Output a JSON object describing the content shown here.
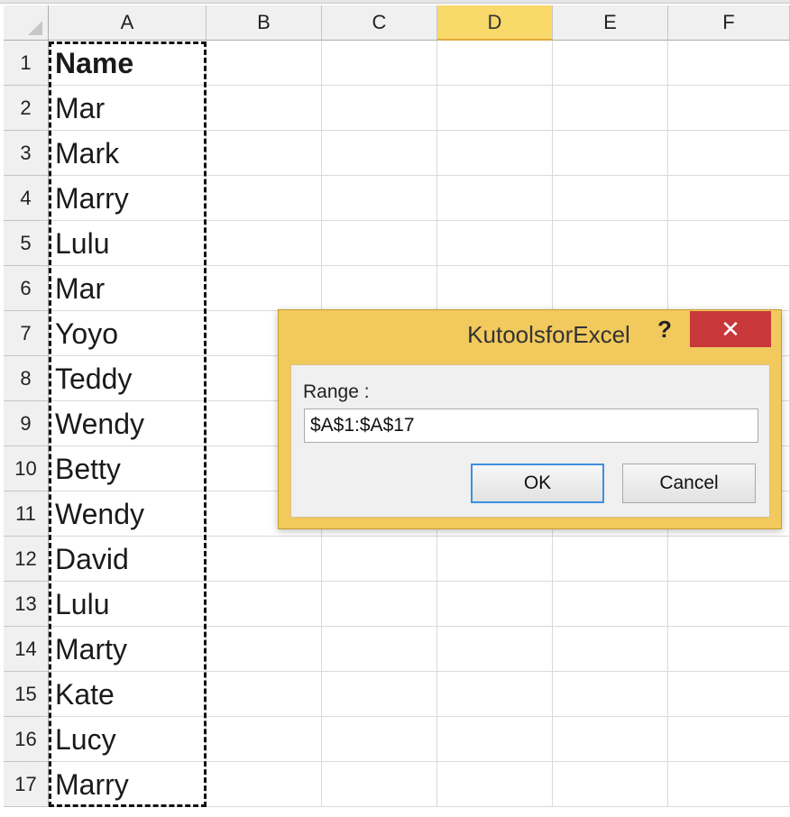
{
  "columns": [
    "A",
    "B",
    "C",
    "D",
    "E",
    "F"
  ],
  "selected_column": "D",
  "rows": [
    "1",
    "2",
    "3",
    "4",
    "5",
    "6",
    "7",
    "8",
    "9",
    "10",
    "11",
    "12",
    "13",
    "14",
    "15",
    "16",
    "17"
  ],
  "column_a_values": [
    "Name",
    "Mar",
    "Mark",
    "Marry",
    "Lulu",
    "Mar",
    "Yoyo",
    "Teddy",
    "Wendy",
    "Betty",
    "Wendy",
    "David",
    "Lulu",
    "Marty",
    "Kate",
    "Lucy",
    "Marry"
  ],
  "dialog": {
    "title": "KutoolsforExcel",
    "help_label": "?",
    "close_label": "✕",
    "range_label": "Range :",
    "range_value": "$A$1:$A$17",
    "ok_label": "OK",
    "cancel_label": "Cancel"
  },
  "colors": {
    "selected_header": "#f8d96a",
    "dialog_frame": "#f2c95d",
    "close_button": "#c8373a",
    "ok_focus_border": "#3c8fe0"
  }
}
